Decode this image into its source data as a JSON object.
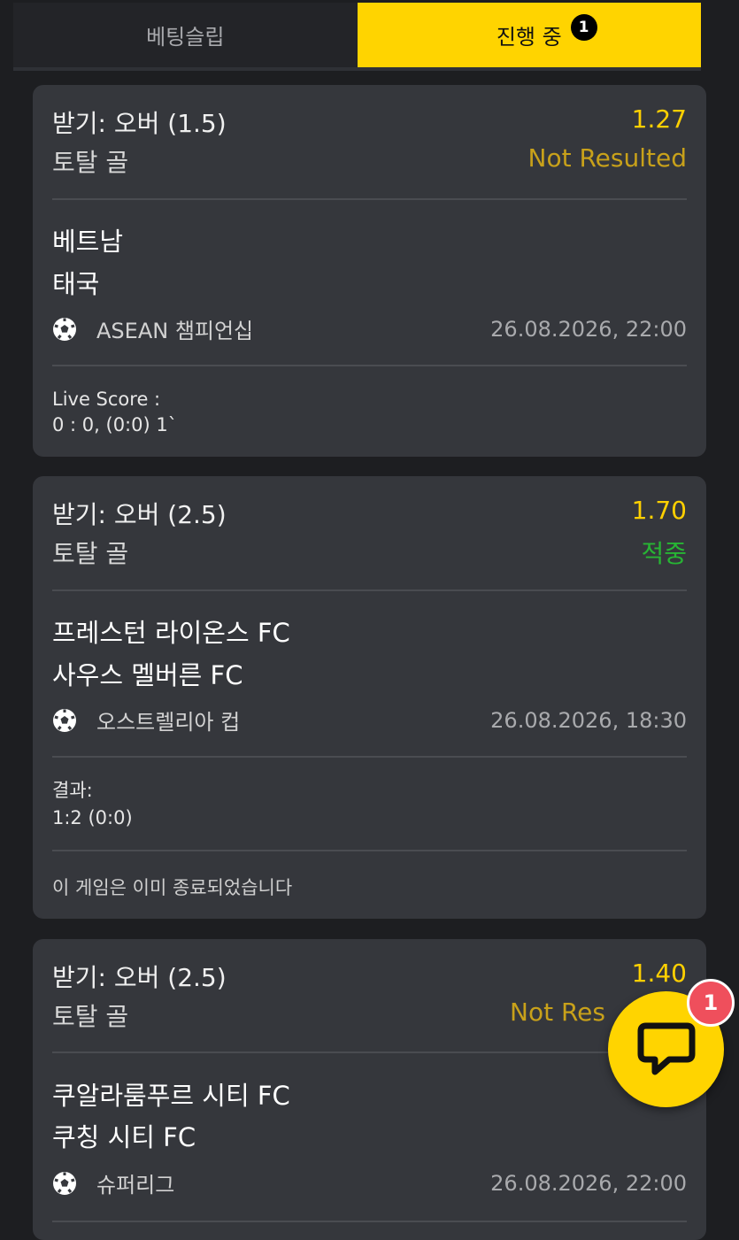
{
  "tabs": {
    "bet_slip": "베팅슬립",
    "in_progress": "진행 중",
    "in_progress_count": "1"
  },
  "bets": [
    {
      "market": "받기: 오버 (1.5)",
      "odds": "1.27",
      "type": "토탈 골",
      "status": "Not Resulted",
      "home": "베트남",
      "away": "태국",
      "league": "ASEAN 챔피언십",
      "datetime": "26.08.2026, 22:00",
      "score_label": "Live Score :",
      "score_value": "0 : 0, (0:0) 1`"
    },
    {
      "market": "받기: 오버 (2.5)",
      "odds": "1.70",
      "type": "토탈 골",
      "status": "적중",
      "home": "프레스턴 라이온스 FC",
      "away": "사우스 멜버른 FC",
      "league": "오스트렐리아 컵",
      "datetime": "26.08.2026, 18:30",
      "score_label": "결과:",
      "score_value": "1:2 (0:0)",
      "note": "이 게임은 이미 종료되었습니다"
    },
    {
      "market": "받기: 오버 (2.5)",
      "odds": "1.40",
      "type": "토탈 골",
      "status": "Not Res",
      "home": "쿠알라룸푸르 시티 FC",
      "away": "쿠칭 시티 FC",
      "league": "슈퍼리그",
      "datetime": "26.08.2026, 22:00"
    }
  ],
  "chat": {
    "badge": "1",
    "icon": "chat-bubble-icon"
  },
  "colors": {
    "accent": "#ffd400",
    "odds": "#ffd000",
    "pending": "#c8a11a",
    "win": "#27b534",
    "card": "#35373c",
    "background": "#1d1e21"
  }
}
